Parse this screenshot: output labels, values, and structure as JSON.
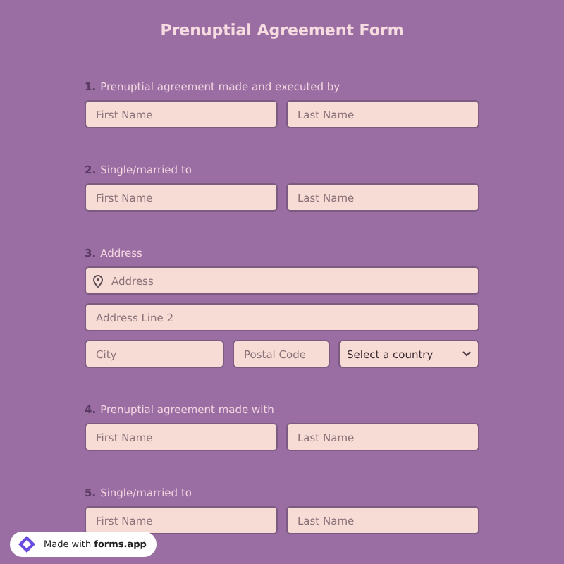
{
  "title": "Prenuptial Agreement Form",
  "questions": [
    {
      "number": "1.",
      "label": "Prenuptial agreement made and executed by",
      "kind": "name",
      "fields": [
        {
          "placeholder": "First Name"
        },
        {
          "placeholder": "Last Name"
        }
      ]
    },
    {
      "number": "2.",
      "label": "Single/married to",
      "kind": "name",
      "fields": [
        {
          "placeholder": "First Name"
        },
        {
          "placeholder": "Last Name"
        }
      ]
    },
    {
      "number": "3.",
      "label": "Address",
      "kind": "address",
      "fields": [
        {
          "placeholder": "Address"
        },
        {
          "placeholder": "Address Line 2"
        },
        {
          "placeholder": "City"
        },
        {
          "placeholder": "Postal Code"
        }
      ],
      "country": "Select a country"
    },
    {
      "number": "4.",
      "label": "Prenuptial agreement made with",
      "kind": "name",
      "fields": [
        {
          "placeholder": "First Name"
        },
        {
          "placeholder": "Last Name"
        }
      ]
    },
    {
      "number": "5.",
      "label": "Single/married to",
      "kind": "name",
      "fields": [
        {
          "placeholder": "First Name"
        },
        {
          "placeholder": "Last Name"
        }
      ]
    }
  ],
  "badge": "Made with **forms.app**"
}
